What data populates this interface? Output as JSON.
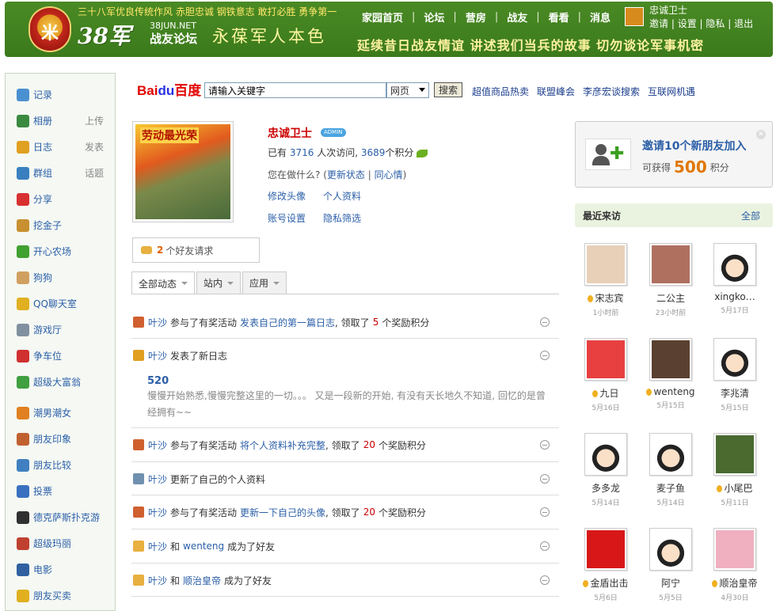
{
  "header": {
    "slogan_top": "三十八军优良传统作风  赤胆忠诚  钢铁意志  敢打必胜  勇争第一",
    "logo_big": "38军",
    "logo_sub1": "38JUN.NET",
    "logo_sub2": "战友论坛",
    "calligraphy": "永葆军人本色",
    "banner_slogan": "延续昔日战友情谊  讲述我们当兵的故事  切勿谈论军事机密",
    "nav": [
      "家园首页",
      "论坛",
      "营房",
      "战友",
      "看看",
      "消息"
    ],
    "user_name": "忠诚卫士",
    "user_links": [
      "邀请",
      "设置",
      "隐私",
      "退出"
    ]
  },
  "sidebar": {
    "items": [
      {
        "label": "记录",
        "extra": "",
        "icon": "speech-icon",
        "color": "#4a90d0"
      },
      {
        "label": "相册",
        "extra": "上传",
        "icon": "photo-icon",
        "color": "#3a8a40"
      },
      {
        "label": "日志",
        "extra": "发表",
        "icon": "journal-icon",
        "color": "#e0a020"
      },
      {
        "label": "群组",
        "extra": "话题",
        "icon": "group-icon",
        "color": "#3a80c0"
      },
      {
        "label": "分享",
        "extra": "",
        "icon": "heart-icon",
        "color": "#d83030"
      },
      {
        "label": "挖金子",
        "extra": "",
        "icon": "gold-icon",
        "color": "#c89030"
      },
      {
        "label": "开心农场",
        "extra": "",
        "icon": "plant-icon",
        "color": "#40a030"
      },
      {
        "label": "狗狗",
        "extra": "",
        "icon": "dog-icon",
        "color": "#d0a060"
      },
      {
        "label": "QQ聊天室",
        "extra": "",
        "icon": "chat-icon",
        "color": "#e0b020"
      },
      {
        "label": "游戏厅",
        "extra": "",
        "icon": "gamepad-icon",
        "color": "#8090a0"
      },
      {
        "label": "争车位",
        "extra": "",
        "icon": "parking-icon",
        "color": "#d03030"
      },
      {
        "label": "超级大富翁",
        "extra": "",
        "icon": "money-icon",
        "color": "#40a040"
      },
      {
        "label": "潮男潮女",
        "extra": "",
        "icon": "people-icon",
        "color": "#e08020"
      },
      {
        "label": "朋友印象",
        "extra": "",
        "icon": "impression-icon",
        "color": "#c06030"
      },
      {
        "label": "朋友比较",
        "extra": "",
        "icon": "compare-icon",
        "color": "#4080c0"
      },
      {
        "label": "投票",
        "extra": "",
        "icon": "vote-icon",
        "color": "#3a70c0"
      },
      {
        "label": "德克萨斯扑克游",
        "extra": "",
        "icon": "poker-icon",
        "color": "#303030"
      },
      {
        "label": "超级玛丽",
        "extra": "",
        "icon": "mario-icon",
        "color": "#c04030"
      },
      {
        "label": "电影",
        "extra": "",
        "icon": "film-icon",
        "color": "#3060a0"
      },
      {
        "label": "朋友买卖",
        "extra": "",
        "icon": "coin-icon",
        "color": "#e0b020"
      }
    ]
  },
  "search": {
    "logo_bai": "Bai",
    "logo_du": "du",
    "logo_cn": "百度",
    "placeholder": "请输入关键字",
    "type": "网页",
    "button": "搜索",
    "links": [
      "超值商品热卖",
      "联盟峰会",
      "李彦宏谈搜索",
      "互联网机遇"
    ]
  },
  "profile": {
    "poster_text": "劳动最光荣",
    "name": "忠诚卫士",
    "badge": "ADMIN",
    "stats_prefix": "已有",
    "visits": "3716",
    "stats_mid": "人次访问,",
    "points": "3689",
    "stats_suffix": "个积分",
    "doing_prompt": "您在做什么?",
    "doing_link1": "更新状态",
    "doing_link2": "同心情",
    "links1": [
      "修改头像",
      "个人资料"
    ],
    "links2": [
      "账号设置",
      "隐私筛选"
    ],
    "friend_req_count": "2",
    "friend_req_text": "个好友请求"
  },
  "tabs": [
    "全部动态",
    "站内",
    "应用"
  ],
  "feed": [
    {
      "who": "叶沙",
      "act": "参与了有奖活动",
      "link": "发表自己的第一篇日志",
      "mid": ", 领取了",
      "n": "5",
      "tail": "个奖励积分",
      "icon": "award-icon"
    },
    {
      "who": "叶沙",
      "act": "发表了新日志",
      "link": "",
      "mid": "",
      "n": "",
      "tail": "",
      "icon": "journal-icon"
    },
    {
      "who": "叶沙",
      "act": "参与了有奖活动",
      "link": "将个人资料补充完整",
      "mid": ", 领取了",
      "n": "20",
      "tail": "个奖励积分",
      "icon": "award-icon"
    },
    {
      "who": "叶沙",
      "act": "更新了自己的个人资料",
      "link": "",
      "mid": "",
      "n": "",
      "tail": "",
      "icon": "profile-card-icon"
    },
    {
      "who": "叶沙",
      "act": "参与了有奖活动",
      "link": "更新一下自己的头像",
      "mid": ", 领取了",
      "n": "20",
      "tail": "个奖励积分",
      "icon": "award-icon"
    },
    {
      "who": "叶沙",
      "act": "和",
      "link": "wenteng",
      "mid": "",
      "n": "",
      "tail": "成为了好友",
      "icon": "handshake-icon"
    },
    {
      "who": "叶沙",
      "act": "和",
      "link": "顺治皇帝",
      "mid": "",
      "n": "",
      "tail": "成为了好友",
      "icon": "handshake-icon"
    }
  ],
  "blog": {
    "title": "520",
    "body": "慢慢开始熟悉,慢慢完整这里的一切。。。  又是一段新的开始,  有没有天长地久不知道,  回忆的是曾经拥有~~"
  },
  "invite": {
    "title": "邀请10个新朋友加入",
    "sub_prefix": "可获得",
    "amount": "500",
    "sub_suffix": "积分"
  },
  "recent": {
    "title": "最近来访",
    "all": "全部",
    "visitors": [
      {
        "name": "宋志宾",
        "time": "1小时前",
        "online": true,
        "color": "#e8d0b8"
      },
      {
        "name": "二公主",
        "time": "23小时前",
        "online": false,
        "color": "#b07060"
      },
      {
        "name": "xingko…",
        "time": "5月17日",
        "online": false,
        "color": "cartoon"
      },
      {
        "name": "九日",
        "time": "5月16日",
        "online": true,
        "color": "#e84040"
      },
      {
        "name": "wenteng",
        "time": "5月15日",
        "online": true,
        "color": "#5a4030"
      },
      {
        "name": "李兆清",
        "time": "5月15日",
        "online": false,
        "color": "cartoon"
      },
      {
        "name": "多多龙",
        "time": "5月14日",
        "online": false,
        "color": "cartoon"
      },
      {
        "name": "麦子鱼",
        "time": "5月14日",
        "online": false,
        "color": "cartoon"
      },
      {
        "name": "小尾巴",
        "time": "5月11日",
        "online": true,
        "color": "#4a6a30"
      },
      {
        "name": "金盾出击",
        "time": "5月6日",
        "online": true,
        "color": "#d81818"
      },
      {
        "name": "阿宁",
        "time": "5月5日",
        "online": false,
        "color": "cartoon"
      },
      {
        "name": "顺治皇帝",
        "time": "4月30日",
        "online": true,
        "color": "#f0b0c0"
      }
    ]
  }
}
